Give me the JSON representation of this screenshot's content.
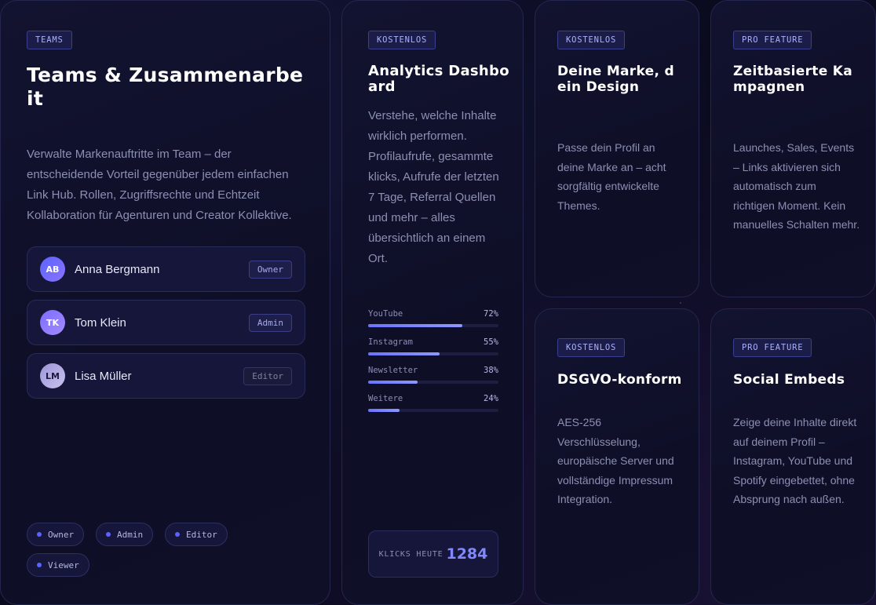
{
  "colors": {
    "background": "#0b0b20",
    "accent": "#6a74ff",
    "badge_text": "#aab0ff"
  },
  "teams": {
    "badge": "TEAMS",
    "title": "Teams & Zusammenarbeit",
    "description": "Verwalte Markenauftritte im Team – der entscheidende Vorteil gegenüber jedem einfachen Link Hub. Rollen, Zugriffsrechte und Echtzeit Kollaboration für Agenturen und Creator Kollektive.",
    "members": [
      {
        "initials": "AB",
        "name": "Anna Bergmann",
        "role": "Owner"
      },
      {
        "initials": "TK",
        "name": "Tom Klein",
        "role": "Admin"
      },
      {
        "initials": "LM",
        "name": "Lisa Müller",
        "role": "Editor"
      }
    ],
    "roles": [
      "Owner",
      "Admin",
      "Editor",
      "Viewer"
    ]
  },
  "analytics": {
    "badge": "KOSTENLOS",
    "title": "Analytics Dashboard",
    "description": "Verstehe, welche Inhalte wirklich performen. Profilaufrufe, gesammte klicks, Aufrufe der letzten 7 Tage, Referral Quellen und mehr – alles übersichtlich an einem Ort.",
    "sources": [
      {
        "name": "YouTube",
        "percent_label": "72%",
        "fraction": 0.72
      },
      {
        "name": "Instagram",
        "percent_label": "55%",
        "fraction": 0.55
      },
      {
        "name": "Newsletter",
        "percent_label": "38%",
        "fraction": 0.38
      },
      {
        "name": "Weitere",
        "percent_label": "24%",
        "fraction": 0.24
      }
    ],
    "clicks_label": "KLICKS HEUTE",
    "clicks_value": "1284"
  },
  "brand": {
    "badge": "KOSTENLOS",
    "title": "Deine Marke, dein Design",
    "description": "Passe dein Profil an deine Marke an – acht sorgfältig entwickelte Themes."
  },
  "time": {
    "badge": "PRO FEATURE",
    "title": "Zeitbasierte Kampagnen",
    "description": "Launches, Sales, Events – Links aktivieren sich automatisch zum richtigen Moment. Kein manuelles Schalten mehr."
  },
  "dsgvo": {
    "badge": "KOSTENLOS",
    "title": "DSGVO-konform",
    "description": "AES-256 Verschlüsselung, europäische Server und vollständige Impressum Integration."
  },
  "embeds": {
    "badge": "PRO FEATURE",
    "title": "Social Embeds",
    "description": "Zeige deine Inhalte direkt auf deinem Profil – Instagram, YouTube und Spotify eingebettet, ohne Absprung nach außen."
  }
}
